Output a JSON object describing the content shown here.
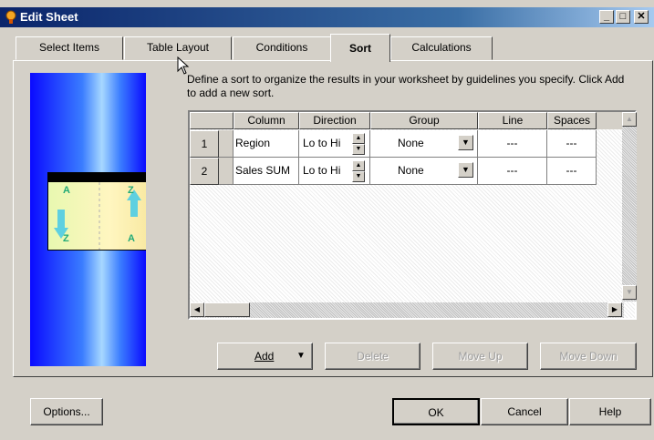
{
  "window": {
    "title": "Edit Sheet",
    "controls": [
      "minimize",
      "maximize",
      "close"
    ]
  },
  "tabs": [
    {
      "label": "Select Items",
      "active": false
    },
    {
      "label": "Table Layout",
      "active": false
    },
    {
      "label": "Conditions",
      "active": false
    },
    {
      "label": "Sort",
      "active": true
    },
    {
      "label": "Calculations",
      "active": false
    }
  ],
  "instructions": "Define a sort to organize the results in your worksheet by guidelines you specify. Click Add to add a new sort.",
  "grid": {
    "columns": [
      "Column",
      "Direction",
      "Group",
      "Line",
      "Spaces"
    ],
    "rows": [
      {
        "num": "1",
        "column": "Region",
        "direction": "Lo to Hi",
        "group": "None",
        "line": "---",
        "spaces": "---"
      },
      {
        "num": "2",
        "column": "Sales SUM",
        "direction": "Lo to Hi",
        "group": "None",
        "line": "---",
        "spaces": "---"
      }
    ]
  },
  "graphic": {
    "letters": [
      "A",
      "Z",
      "Z",
      "A"
    ]
  },
  "buttons": {
    "add": "Add",
    "delete": "Delete",
    "move_up": "Move Up",
    "move_down": "Move Down",
    "options": "Options...",
    "ok": "OK",
    "cancel": "Cancel",
    "help": "Help"
  },
  "colors": {
    "titlebar": "#0a246a",
    "face": "#d4d0c8",
    "graphic_blue": "#0a0aff"
  }
}
